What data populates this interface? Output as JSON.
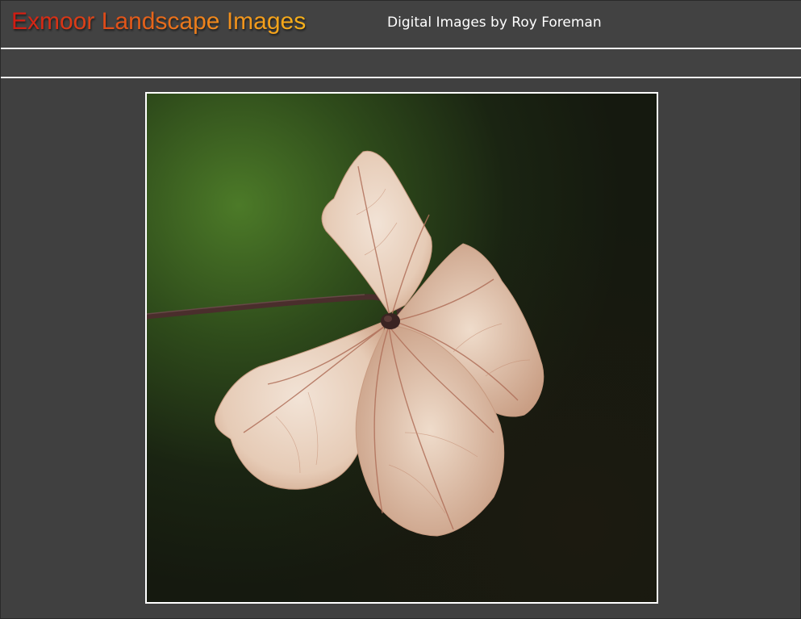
{
  "header": {
    "site_title": "Exmoor Landscape Images",
    "subtitle": "Digital Images by Roy Foreman"
  },
  "colors": {
    "page_background": "#404040",
    "title_gradient_start": "#d21a12",
    "title_gradient_end": "#f6b11a",
    "subtitle_text": "#ffffff",
    "rules": "#f2f2f2",
    "photo_border": "#ffffff"
  },
  "photo": {
    "subject": "dried-leaf-photo"
  }
}
